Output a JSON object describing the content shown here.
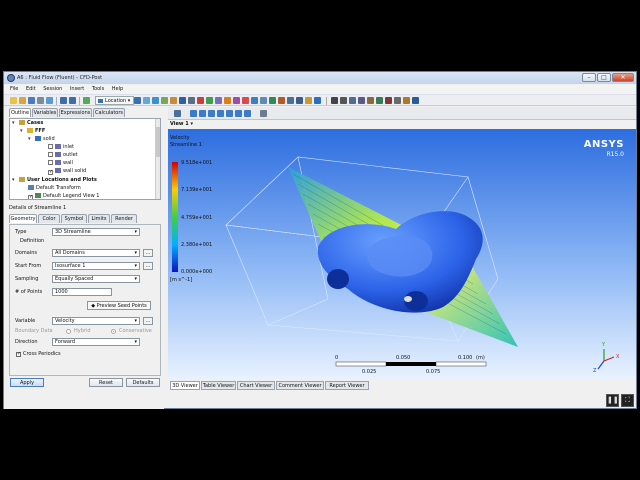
{
  "window": {
    "title": "A6 : Fluid Flow (Fluent) - CFD-Post"
  },
  "menu": [
    "File",
    "Edit",
    "Session",
    "Insert",
    "Tools",
    "Help"
  ],
  "toolbar": {
    "location_label": "Location"
  },
  "left_tabs": [
    "Outline",
    "Variables",
    "Expressions",
    "Calculators"
  ],
  "tree": {
    "cases": "Cases",
    "fff": "FFF",
    "solid": "solid",
    "inlet": "inlet",
    "outlet": "outlet",
    "wall": "wall",
    "wall_solid": "wall solid",
    "user_locations": "User Locations and Plots",
    "default_transform": "Default Transform",
    "default_legend": "Default Legend View 1"
  },
  "details": {
    "title": "Details of Streamline 1",
    "tabs": [
      "Geometry",
      "Color",
      "Symbol",
      "Limits",
      "Render"
    ],
    "type_label": "Type",
    "type_value": "3D Streamline",
    "definition_label": "Definition",
    "domains_label": "Domains",
    "domains_value": "All Domains",
    "start_from_label": "Start From",
    "start_from_value": "Isosurface 1",
    "sampling_label": "Sampling",
    "sampling_value": "Equally Spaced",
    "points_label": "# of Points",
    "points_value": "1000",
    "preview_label": "Preview Seed Points",
    "variable_label": "Variable",
    "variable_value": "Velocity",
    "boundary_label": "Boundary Data",
    "hybrid_label": "Hybrid",
    "conservative_label": "Conservative",
    "direction_label": "Direction",
    "direction_value": "Forward",
    "cross_periodics_label": "Cross Periodics",
    "dots": "..."
  },
  "buttons": {
    "apply": "Apply",
    "reset": "Reset",
    "defaults": "Defaults"
  },
  "viewer": {
    "view_label": "View 1",
    "legend_title": "Velocity",
    "legend_subtitle": "Streamline 1",
    "legend_ticks": [
      "9.518e+001",
      "7.139e+001",
      "4.759e+001",
      "2.380e+001",
      "0.000e+000"
    ],
    "legend_unit": "[m s^-1]",
    "brand": "ANSYS",
    "version": "R15.0",
    "scale_top": [
      "0",
      "0.050",
      "0.100",
      "(m)"
    ],
    "scale_bottom": [
      "0.025",
      "0.075"
    ],
    "axis_labels": {
      "x": "X",
      "y": "Y",
      "z": "Z"
    }
  },
  "bottom_tabs": [
    "3D Viewer",
    "Table Viewer",
    "Chart Viewer",
    "Comment Viewer",
    "Report Viewer"
  ],
  "player": {
    "pause": "❚❚",
    "fullscreen": "⛶"
  },
  "colors": {
    "legend_top": "#d40000",
    "legend_bottom": "#1010c0",
    "car": "#2c63e8",
    "background_top": "#2d6de0"
  }
}
